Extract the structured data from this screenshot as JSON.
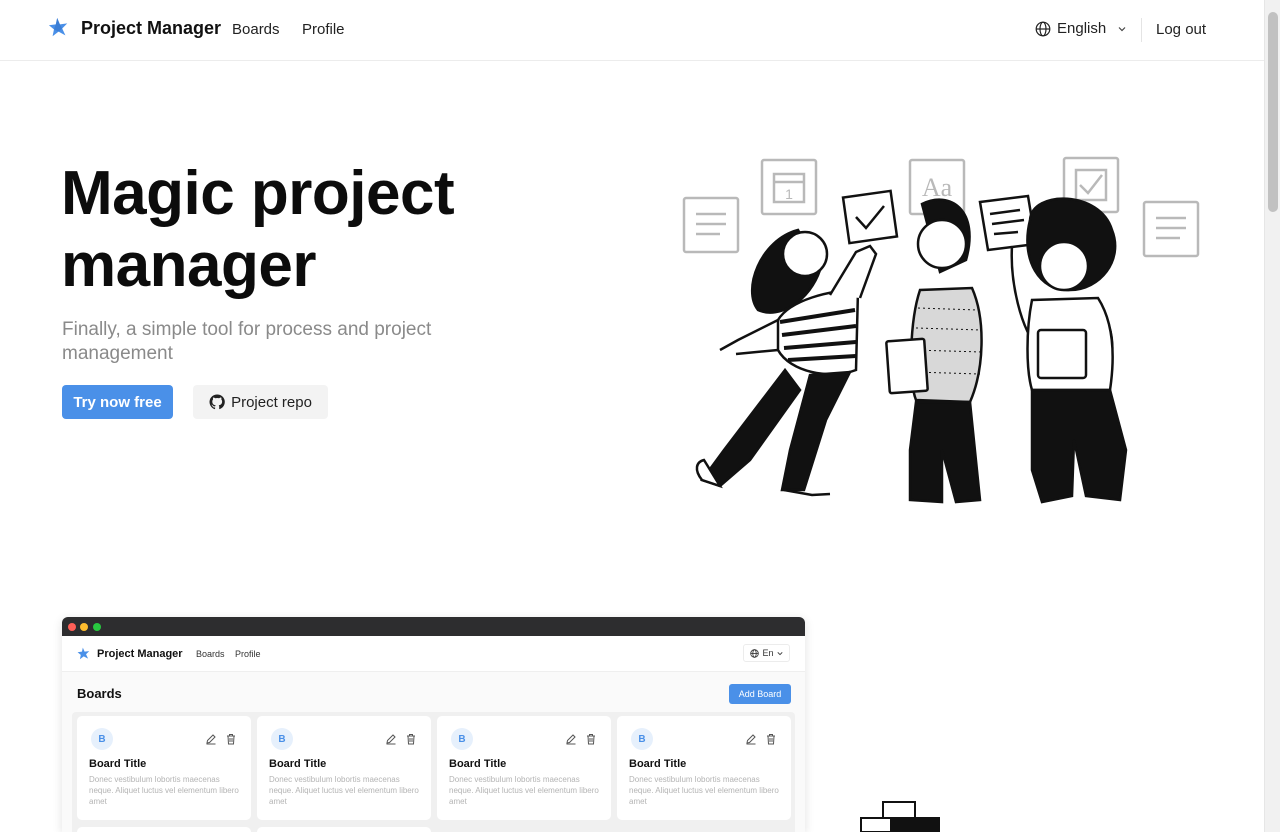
{
  "header": {
    "brand": "Project Manager",
    "nav": {
      "boards": "Boards",
      "profile": "Profile"
    },
    "language": "English",
    "logout": "Log out"
  },
  "hero": {
    "title": "Magic project manager",
    "subtitle": "Finally, a simple tool for process and project management",
    "primary_button": "Try now free",
    "secondary_button": "Project repo"
  },
  "illustration": {
    "calendar_day": "1",
    "font_sample": "Aa"
  },
  "preview": {
    "brand": "Project Manager",
    "nav": {
      "boards": "Boards",
      "profile": "Profile"
    },
    "language": "En",
    "title": "Boards",
    "add_button": "Add Board",
    "cards": [
      {
        "avatar": "B",
        "title": "Board Title",
        "description": "Donec vestibulum lobortis maecenas neque. Aliquet luctus vel elementum libero amet"
      },
      {
        "avatar": "B",
        "title": "Board Title",
        "description": "Donec vestibulum lobortis maecenas neque. Aliquet luctus vel elementum libero amet"
      },
      {
        "avatar": "B",
        "title": "Board Title",
        "description": "Donec vestibulum lobortis maecenas neque. Aliquet luctus vel elementum libero amet"
      },
      {
        "avatar": "B",
        "title": "Board Title",
        "description": "Donec vestibulum lobortis maecenas neque. Aliquet luctus vel elementum libero amet"
      }
    ]
  },
  "colors": {
    "accent": "#4a90e8",
    "text_primary": "#0c0c0c",
    "text_muted": "#8a8a8a",
    "secondary_button_bg": "#f3f3f3"
  },
  "icons": {
    "logo": "star-logo-icon",
    "language": "globe-icon",
    "dropdown": "chevron-down-icon",
    "repo": "github-icon",
    "edit": "pencil-icon",
    "delete": "trash-icon"
  }
}
